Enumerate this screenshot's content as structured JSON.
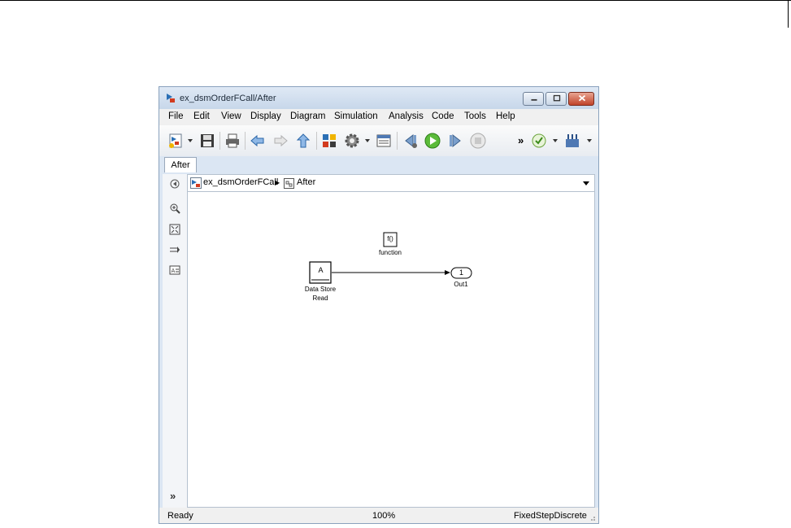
{
  "window": {
    "title": "ex_dsmOrderFCall/After"
  },
  "menu": [
    "File",
    "Edit",
    "View",
    "Display",
    "Diagram",
    "Simulation",
    "Analysis",
    "Code",
    "Tools",
    "Help"
  ],
  "toolbar": {
    "more_label": "»",
    "icons": [
      "new-model-icon",
      "save-icon",
      "print-icon",
      "back-icon",
      "forward-icon",
      "up-icon",
      "library-browser-icon",
      "model-config-icon",
      "model-explorer-icon",
      "step-back-icon",
      "run-icon",
      "step-forward-icon",
      "stop-icon",
      "model-advisor-icon",
      "build-icon"
    ]
  },
  "tab": {
    "label": "After"
  },
  "breadcrumb": {
    "root": "ex_dsmOrderFCall",
    "separator": "▶",
    "current": "After"
  },
  "leftbar": {
    "expand_label": "»"
  },
  "diagram": {
    "function_block": {
      "text": "f()",
      "label": "function"
    },
    "dsr_block": {
      "text": "A",
      "label_line1": "Data Store",
      "label_line2": "Read"
    },
    "outport_block": {
      "number": "1",
      "label": "Out1"
    }
  },
  "status": {
    "left": "Ready",
    "zoom": "100%",
    "solver": "FixedStepDiscrete"
  }
}
